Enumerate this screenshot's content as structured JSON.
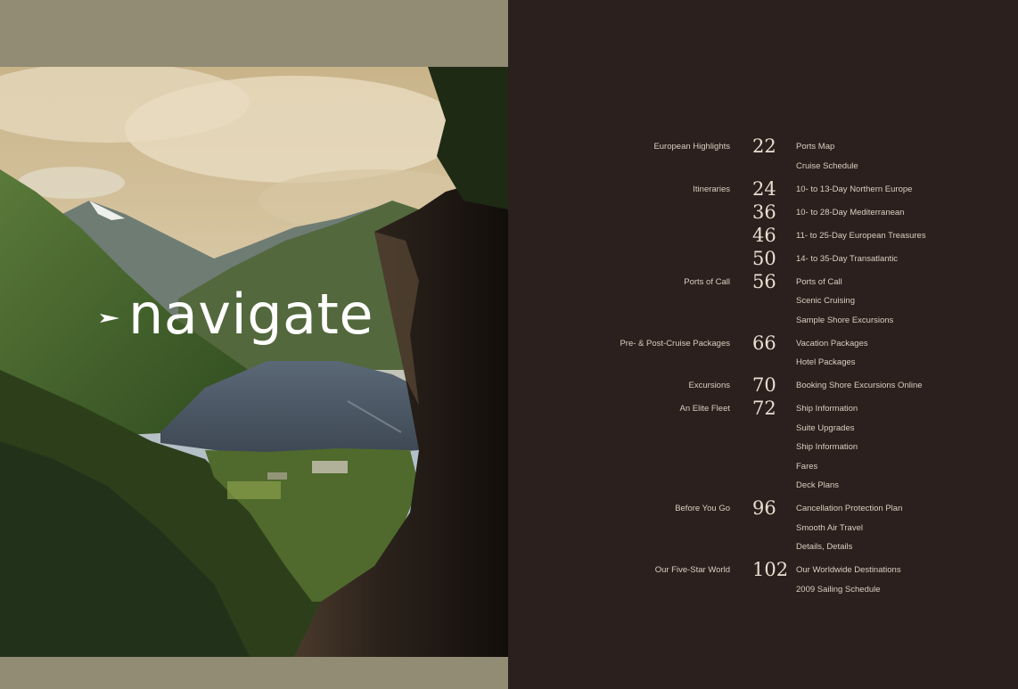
{
  "headline": "navigate",
  "toc": [
    {
      "section": "European Highlights",
      "page": "22",
      "items": [
        "Ports Map",
        "Cruise Schedule"
      ]
    },
    {
      "section": "Itineraries",
      "page": "24",
      "items": [
        "10- to 13-Day Northern Europe"
      ]
    },
    {
      "section": "",
      "page": "36",
      "items": [
        "10- to 28-Day Mediterranean"
      ]
    },
    {
      "section": "",
      "page": "46",
      "items": [
        "11- to 25-Day European Treasures"
      ]
    },
    {
      "section": "",
      "page": "50",
      "items": [
        "14- to 35-Day Transatlantic"
      ]
    },
    {
      "section": "Ports of Call",
      "page": "56",
      "items": [
        "Ports of Call",
        "Scenic Cruising",
        "Sample Shore Excursions"
      ]
    },
    {
      "section": "Pre- & Post-Cruise Packages",
      "page": "66",
      "items": [
        "Vacation Packages",
        "Hotel Packages"
      ]
    },
    {
      "section": "Excursions",
      "page": "70",
      "items": [
        "Booking Shore  Excursions Online"
      ]
    },
    {
      "section": "An Elite Fleet",
      "page": "72",
      "items": [
        "Ship Information",
        "Suite Upgrades",
        "Ship Information",
        "Fares",
        "Deck Plans"
      ]
    },
    {
      "section": "Before You Go",
      "page": "96",
      "items": [
        "Cancellation Protection Plan",
        "Smooth Air Travel",
        "Details, Details"
      ]
    },
    {
      "section": "Our Five-Star World",
      "page": "102",
      "items": [
        "Our Worldwide Destinations",
        "2009 Sailing Schedule"
      ]
    }
  ]
}
